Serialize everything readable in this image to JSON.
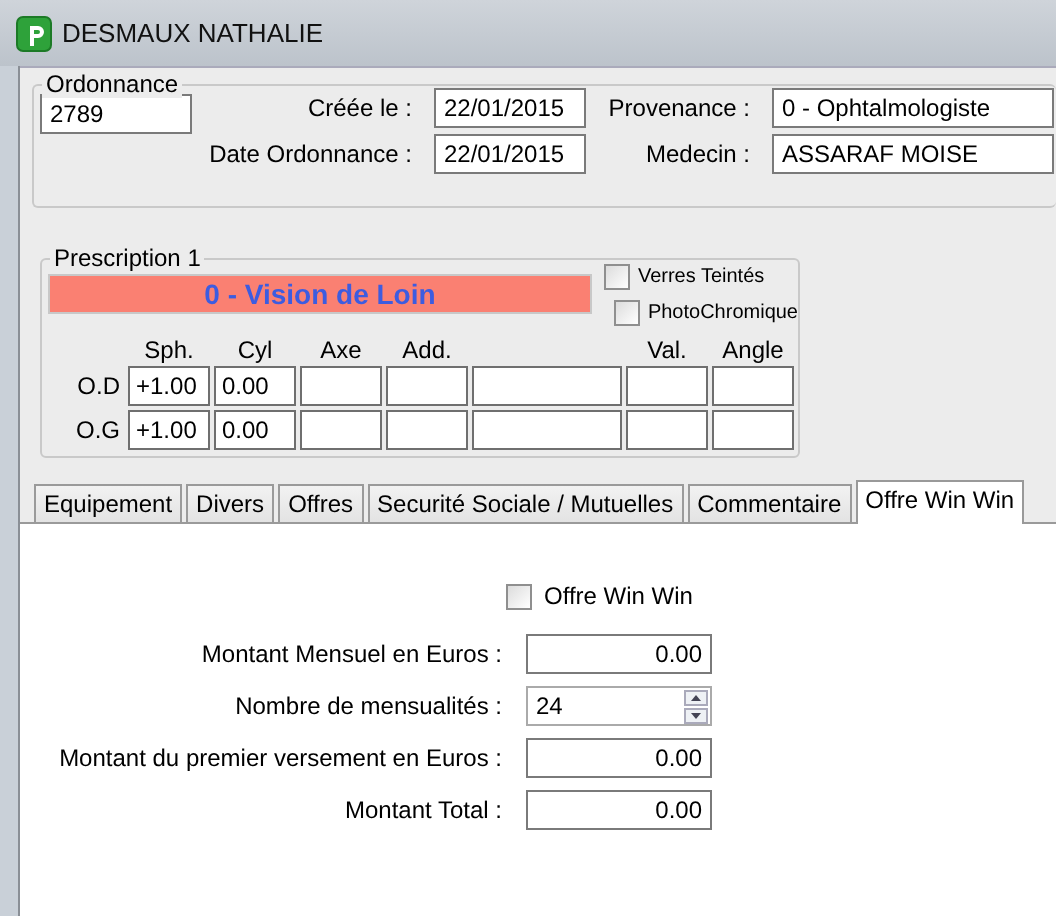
{
  "window": {
    "title": "DESMAUX NATHALIE"
  },
  "ordonnance": {
    "label": "Ordonnance",
    "value": "2789"
  },
  "header_fields": [
    {
      "label": "Créée le :",
      "value": "22/01/2015"
    },
    {
      "label": "Provenance :",
      "value": "0 - Ophtalmologiste"
    },
    {
      "label": "Date Ordonnance :",
      "value": "22/01/2015"
    },
    {
      "label": "Medecin :",
      "value": "ASSARAF MOISE"
    }
  ],
  "prescription": {
    "title": "Prescription 1",
    "vision": "0 - Vision de Loin",
    "options": [
      {
        "label": "Verres Teintés",
        "checked": false
      },
      {
        "label": "PhotoChromique",
        "checked": false
      }
    ],
    "columns": [
      {
        "kind": "labeled",
        "label": "Sph."
      },
      {
        "kind": "labeled",
        "label": "Cyl"
      },
      {
        "kind": "labeled",
        "label": "Axe"
      },
      {
        "kind": "labeled",
        "label": "Add."
      },
      {
        "kind": "blank"
      },
      {
        "kind": "labeled",
        "label": "Val."
      },
      {
        "kind": "labeled",
        "label": "Angle"
      }
    ],
    "rows": [
      {
        "eye": "O.D",
        "values": [
          "+1.00",
          "0.00"
        ]
      },
      {
        "eye": "O.G",
        "values": [
          "+1.00",
          "0.00"
        ]
      }
    ]
  },
  "tabs": [
    {
      "label": "Equipement",
      "selected": false
    },
    {
      "label": "Divers",
      "selected": false
    },
    {
      "label": "Offres",
      "selected": false
    },
    {
      "label": "Securité Sociale / Mutuelles",
      "selected": false
    },
    {
      "label": "Commentaire",
      "selected": false
    },
    {
      "label": "Offre Win Win",
      "selected": true
    }
  ],
  "win_win": {
    "option": {
      "label": "Offre Win Win",
      "checked": false
    },
    "fields": [
      {
        "kind": "amount",
        "label": "Montant Mensuel en Euros :",
        "value": "0.00"
      },
      {
        "kind": "spinner",
        "label": "Nombre de mensualités :",
        "value": "24"
      },
      {
        "kind": "amount",
        "label": "Montant du premier versement en Euros :",
        "value": "0.00"
      },
      {
        "kind": "amount",
        "label": "Montant Total :",
        "value": "0.00"
      }
    ]
  }
}
